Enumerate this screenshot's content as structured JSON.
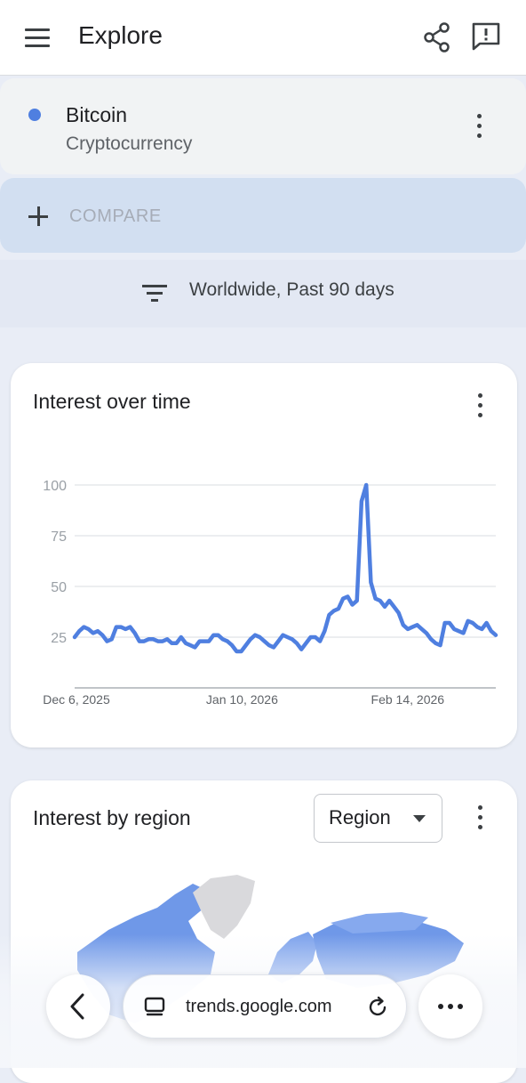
{
  "header": {
    "title": "Explore",
    "menu_icon": "hamburger-menu-icon",
    "share_icon": "share-icon",
    "feedback_icon": "feedback-icon"
  },
  "term": {
    "name": "Bitcoin",
    "category": "Cryptocurrency",
    "color": "#4f7fe0"
  },
  "compare": {
    "label": "COMPARE"
  },
  "filter": {
    "text": "Worldwide, Past 90 days"
  },
  "interest_over_time": {
    "title": "Interest over time"
  },
  "interest_by_region": {
    "title": "Interest by region",
    "select_value": "Region"
  },
  "browser": {
    "url": "trends.google.com",
    "back_icon": "chevron-left-icon",
    "tabs_icon": "tab-switcher-icon",
    "reload_icon": "reload-icon",
    "more_icon": "more-horizontal-icon"
  },
  "colors": {
    "series": "#4f7fe0",
    "compare_bg": "#d2dff1",
    "page_bg": "#e9edf6"
  },
  "chart_data": {
    "type": "line",
    "title": "Interest over time",
    "xlabel": "",
    "ylabel": "",
    "ylim": [
      0,
      100
    ],
    "y_ticks": [
      25,
      50,
      75,
      100
    ],
    "x_tick_labels": [
      "Dec 6, 2025",
      "Jan 10, 2026",
      "Feb 14, 2026"
    ],
    "x_start": "2025-12-06",
    "x_end": "2026-03-05",
    "grid": true,
    "series": [
      {
        "color": "#4f7fe0",
        "values": [
          25,
          28,
          30,
          29,
          27,
          28,
          26,
          23,
          24,
          30,
          30,
          29,
          30,
          27,
          23,
          23,
          24,
          24,
          23,
          23,
          24,
          22,
          22,
          25,
          22,
          21,
          20,
          23,
          23,
          23,
          26,
          26,
          24,
          23,
          21,
          18,
          18,
          21,
          24,
          26,
          25,
          23,
          21,
          20,
          23,
          26,
          25,
          24,
          22,
          19,
          22,
          25,
          25,
          23,
          28,
          36,
          38,
          39,
          44,
          45,
          41,
          43,
          92,
          100,
          52,
          44,
          43,
          40,
          43,
          40,
          37,
          31,
          29,
          30,
          31,
          29,
          27,
          24,
          22,
          21,
          32,
          32,
          29,
          28,
          27,
          33,
          32,
          30,
          29,
          32,
          28,
          26
        ]
      }
    ]
  }
}
